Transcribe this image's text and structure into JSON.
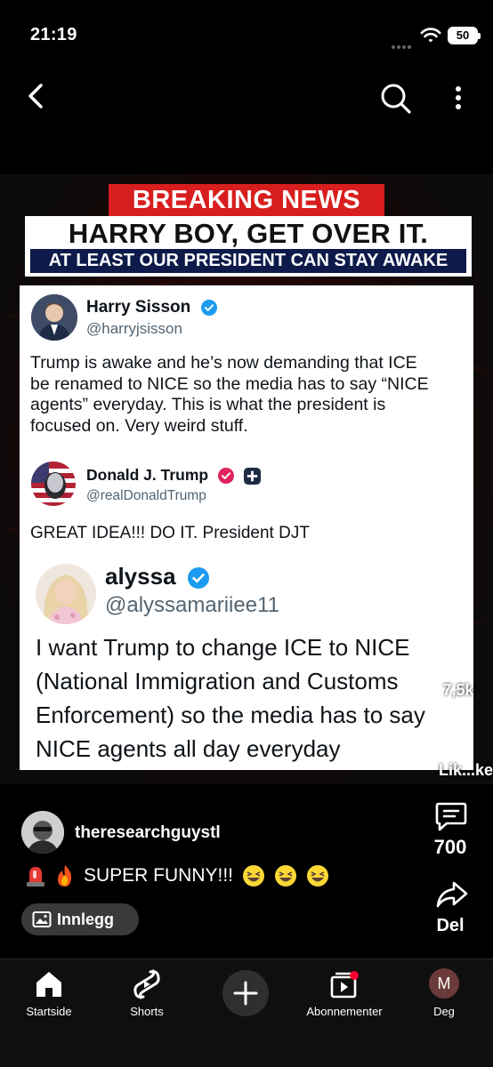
{
  "status_bar": {
    "time": "21:19",
    "battery": "50"
  },
  "post_image": {
    "banner": "BREAKING NEWS",
    "headline": "HARRY BOY, GET OVER IT.",
    "subheadline": "AT LEAST OUR PRESIDENT CAN STAY AWAKE",
    "tweets": [
      {
        "name": "Harry Sisson",
        "handle": "@harryjsisson",
        "text_lines": [
          "Trump is awake and he’s now demanding that ICE",
          "be renamed to NICE so the media has to say “NICE",
          "agents” everyday. This is what the president is",
          "focused on. Very weird stuff."
        ]
      },
      {
        "name": "Donald J. Trump",
        "handle": "@realDonaldTrump",
        "text_lines": [
          "GREAT IDEA!!! DO IT. President DJT"
        ]
      },
      {
        "name": "alyssa",
        "handle": "@alyssamariiee11",
        "text_lines": [
          "I want Trump to change ICE to NICE",
          "(National Immigration and Customs",
          "Enforcement) so the media has to say",
          "NICE agents all day everyday"
        ]
      }
    ]
  },
  "actions": {
    "like_count": "7,5k",
    "dislike_label": "Lik...ke",
    "comment_count": "700",
    "share_label": "Del"
  },
  "post": {
    "channel": "theresearchguystl",
    "caption": "SUPER FUNNY!!!",
    "chip_label": "Innlegg"
  },
  "bottom_nav": {
    "home": "Startside",
    "shorts": "Shorts",
    "subscriptions": "Abonnementer",
    "me": "Deg",
    "me_initial": "M"
  },
  "colors": {
    "breaking_red": "#d81e1e",
    "subheadline_navy": "#0d1a4a",
    "verified_blue": "#1d9bf0",
    "verified_pink": "#e0245e"
  },
  "icons": [
    "back-icon",
    "search-icon",
    "more-vert-icon",
    "thumb-up-icon",
    "thumb-down-icon",
    "comment-icon",
    "share-icon",
    "image-icon",
    "home-icon",
    "shorts-icon",
    "plus-icon",
    "subscriptions-icon"
  ]
}
